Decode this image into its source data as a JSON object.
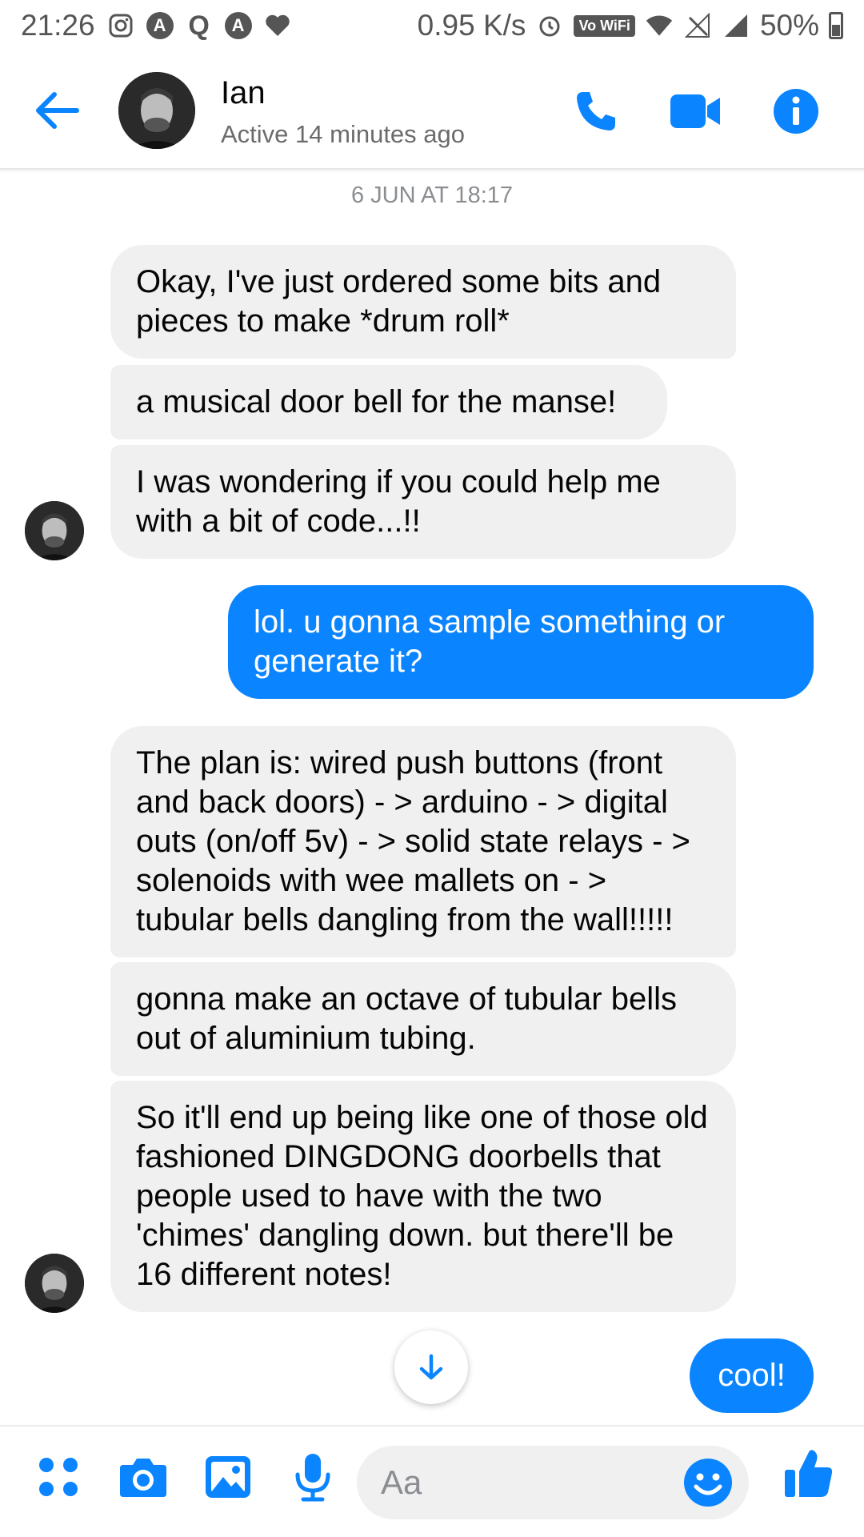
{
  "status_bar": {
    "time": "21:26",
    "net_speed": "0.95 K/s",
    "wifi_label": "Vo WiFi",
    "battery": "50%",
    "app_icons": [
      "instagram-icon",
      "a-icon",
      "q-icon",
      "a-icon",
      "heart-icon"
    ]
  },
  "header": {
    "name": "Ian",
    "status": "Active 14 minutes ago",
    "actions": [
      "phone-icon",
      "video-camera-icon",
      "info-icon"
    ]
  },
  "conversation": {
    "timestamp": "6 JUN AT 18:17",
    "messages": [
      {
        "from": "them",
        "text": "Okay, I've just ordered some bits and pieces to make *drum roll*"
      },
      {
        "from": "them",
        "text": "a musical door bell for the manse!"
      },
      {
        "from": "them",
        "text": "I was wondering if you could help me with a bit of code...!!"
      },
      {
        "from": "me",
        "text": "lol. u gonna sample something or generate it?"
      },
      {
        "from": "them",
        "text": "The plan is:  wired push buttons (front and back doors) - > arduino - > digital outs (on/off 5v) - > solid state relays - > solenoids with wee mallets on - > tubular bells dangling from the wall!!!!!"
      },
      {
        "from": "them",
        "text": "gonna make an octave of tubular bells out of aluminium tubing."
      },
      {
        "from": "them",
        "text": "So it'll end up being like one of those old fashioned DINGDONG doorbells that people used to have with the two 'chimes' dangling down.  but there'll be 16 different notes!"
      },
      {
        "from": "me",
        "text": "cool!"
      }
    ]
  },
  "composer": {
    "placeholder": "Aa",
    "icons": [
      "apps-icon",
      "camera-icon",
      "gallery-icon",
      "microphone-icon",
      "emoji-icon",
      "thumbs-up-icon"
    ]
  },
  "colors": {
    "accent": "#0a84ff",
    "received_bubble": "#f0f0f0",
    "sent_text": "#ffffff"
  }
}
